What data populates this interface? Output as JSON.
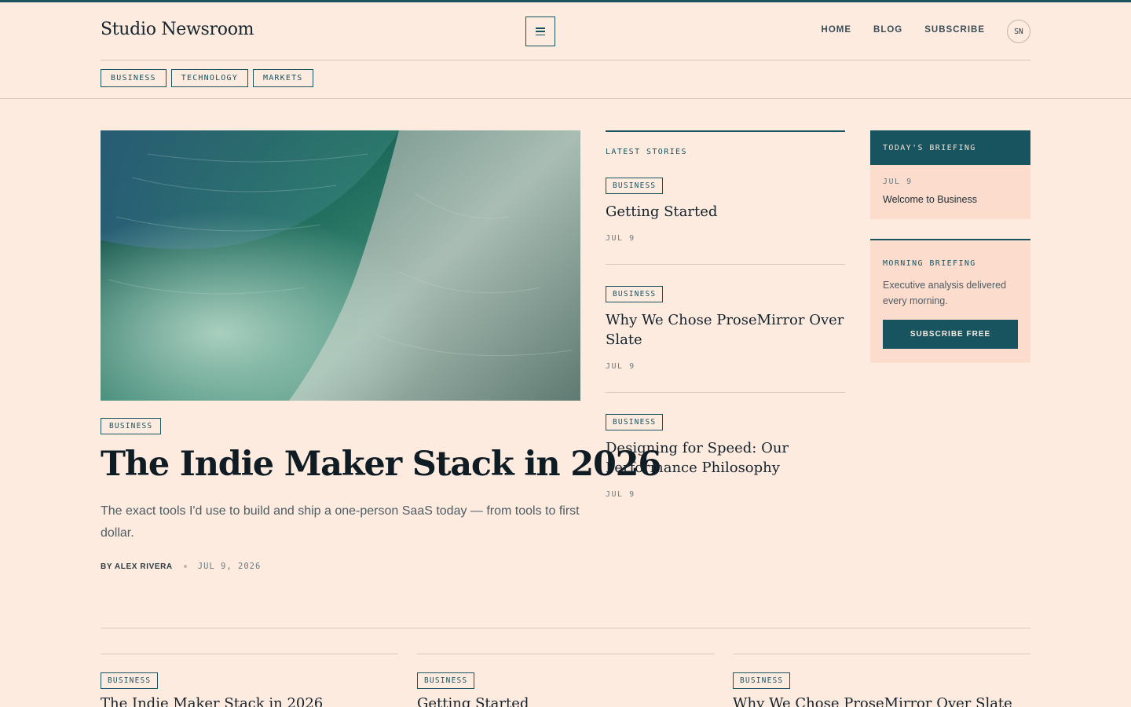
{
  "brand": {
    "name": "Studio Newsroom",
    "avatar_initials": "SN"
  },
  "header": {
    "nav": [
      "HOME",
      "BLOG",
      "SUBSCRIBE"
    ],
    "menu_icon": "hamburger-icon"
  },
  "categories": [
    "BUSINESS",
    "TECHNOLOGY",
    "MARKETS"
  ],
  "hero": {
    "category": "BUSINESS",
    "title": "The Indie Maker Stack in 2026",
    "dek": "The exact tools I'd use to build and ship a one-person SaaS today — from tools to first dollar.",
    "byline": "BY ALEX RIVERA",
    "date": "JUL 9, 2026"
  },
  "latest": {
    "heading": "LATEST STORIES",
    "stories": [
      {
        "category": "BUSINESS",
        "title": "Getting Started",
        "date": "JUL 9"
      },
      {
        "category": "BUSINESS",
        "title": "Why We Chose ProseMirror Over Slate",
        "date": "JUL 9"
      },
      {
        "category": "BUSINESS",
        "title": "Designing for Speed: Our Performance Philosophy",
        "date": "JUL 9"
      }
    ]
  },
  "briefing": {
    "heading": "TODAY'S BRIEFING",
    "date": "JUL 9",
    "title": "Welcome to Business"
  },
  "morning": {
    "heading": "MORNING BRIEFING",
    "text": "Executive analysis delivered every morning.",
    "button": "SUBSCRIBE FREE"
  },
  "cards": [
    {
      "category": "BUSINESS",
      "title": "The Indie Maker Stack in 2026"
    },
    {
      "category": "BUSINESS",
      "title": "Getting Started"
    },
    {
      "category": "BUSINESS",
      "title": "Why We Chose ProseMirror Over Slate"
    }
  ],
  "colors": {
    "background": "#fdebe0",
    "accent": "#17545f",
    "panel": "#fbdccd",
    "ink": "#14232c"
  }
}
